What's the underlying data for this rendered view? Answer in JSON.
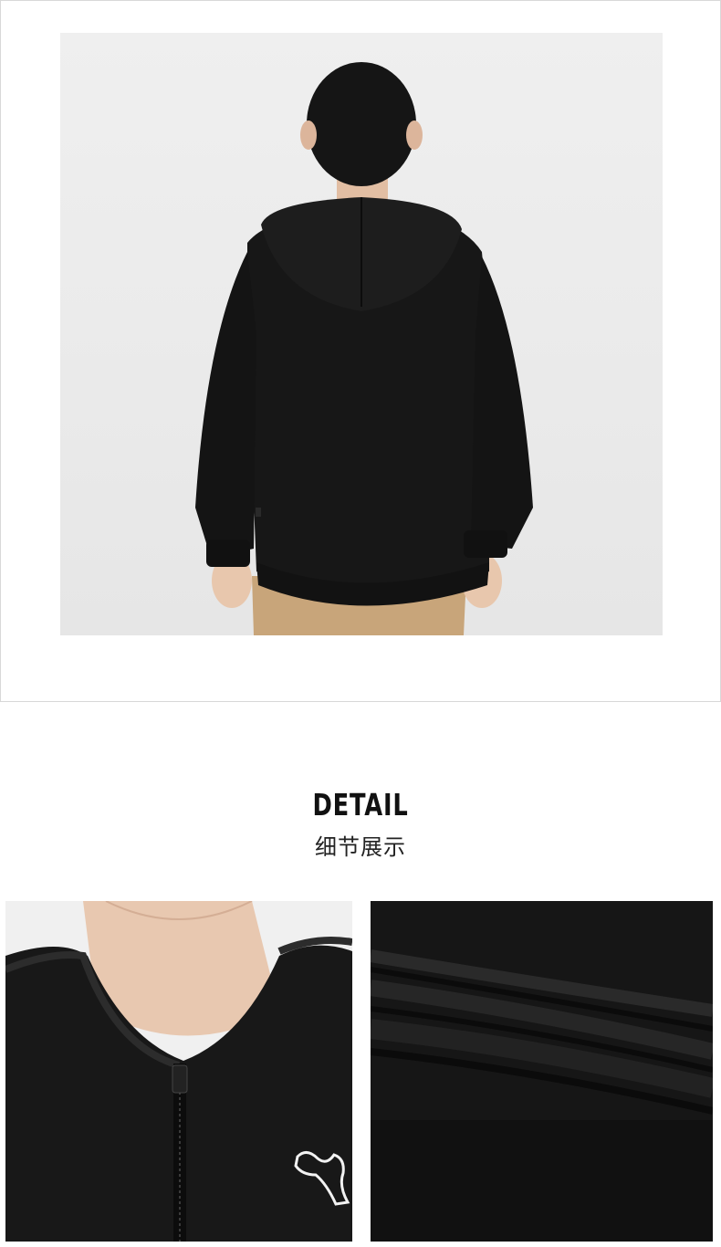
{
  "hero": {
    "subject": "hoodie-back-view"
  },
  "section": {
    "title": "DETAIL",
    "subtitle": "细节展示"
  },
  "details": [
    {
      "subject": "zipper-chest-logo"
    },
    {
      "subject": "rib-knit-fabric"
    }
  ]
}
